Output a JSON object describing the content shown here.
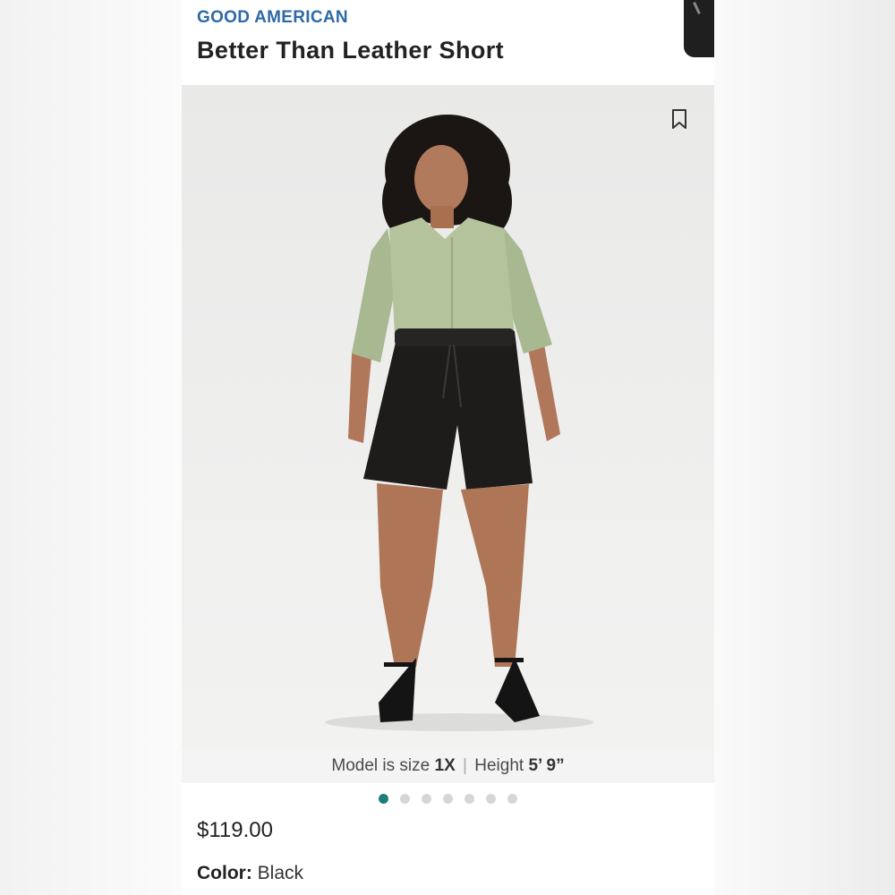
{
  "product": {
    "brand": "GOOD AMERICAN",
    "title": "Better Than Leather Short",
    "price": "$119.00",
    "color_label": "Color:",
    "color_value": "Black"
  },
  "model_info": {
    "prefix": "Model is size",
    "size": "1X",
    "separator": "|",
    "height_label": "Height",
    "height_value": "5’ 9”"
  },
  "gallery": {
    "total_images": 7,
    "active_index": 0,
    "bookmark_icon": "bookmark-icon"
  },
  "colors": {
    "brand": "#2d6aa8",
    "active_dot": "#1f7f78",
    "inactive_dot": "#d6d6d6"
  }
}
